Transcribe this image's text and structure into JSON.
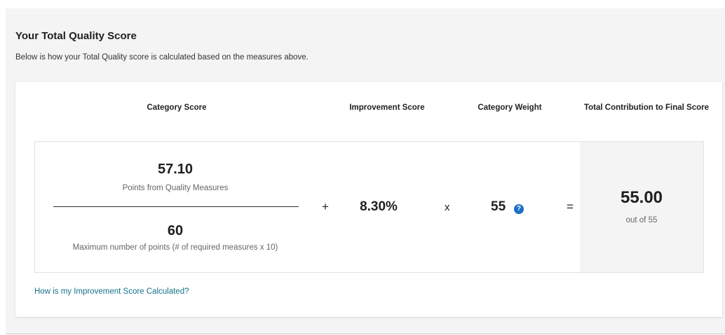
{
  "header": {
    "title": "Your Total Quality Score",
    "subtitle": "Below is how your Total Quality score is calculated based on the measures above."
  },
  "columns": {
    "category_score": "Category Score",
    "improvement_score": "Improvement Score",
    "category_weight": "Category Weight",
    "total_contribution": "Total Contribution to Final Score"
  },
  "calculation": {
    "numerator_value": "57.10",
    "numerator_label": "Points from Quality Measures",
    "denominator_value": "60",
    "denominator_label": "Maximum number of points (# of required measures x 10)",
    "plus": "+",
    "improvement": "8.30%",
    "times": "x",
    "weight": "55",
    "help_glyph": "?",
    "equals": "=",
    "total": "55.00",
    "out_of": "out of 55"
  },
  "link": {
    "label": "How is my Improvement Score Calculated?"
  },
  "colors": {
    "accent_link": "#14738a",
    "help_icon": "#1c6fc4",
    "panel_bg": "#f4f4f4"
  },
  "icons": {
    "help": "question-circle-icon"
  }
}
